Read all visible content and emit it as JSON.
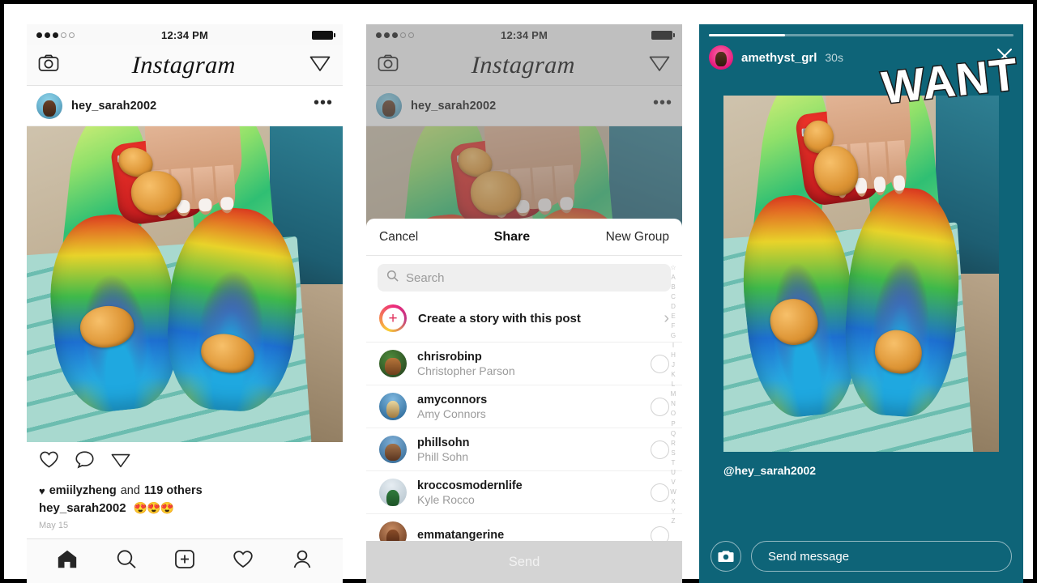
{
  "status_bar": {
    "time": "12:34 PM",
    "signal_filled": 3,
    "signal_empty": 2
  },
  "app": {
    "logo_text": "Instagram"
  },
  "post": {
    "username": "hey_sarah2002",
    "likes_prefix_user": "emiilyzheng",
    "likes_middle": "and",
    "likes_count": "119 others",
    "caption_user": "hey_sarah2002",
    "caption_emojis": "😍😍😍",
    "date": "May 15",
    "more_icon": "more-options-icon"
  },
  "tabbar": {
    "items": [
      {
        "name": "home-icon",
        "label": "Home"
      },
      {
        "name": "search-icon",
        "label": "Search"
      },
      {
        "name": "add-post-icon",
        "label": "Add"
      },
      {
        "name": "activity-heart-icon",
        "label": "Activity"
      },
      {
        "name": "profile-icon",
        "label": "Profile"
      }
    ]
  },
  "share_sheet": {
    "cancel_label": "Cancel",
    "title": "Share",
    "new_group_label": "New Group",
    "search_placeholder": "Search",
    "create_story_label": "Create a story with this post",
    "send_label": "Send",
    "index_letters": [
      "☆",
      "A",
      "B",
      "C",
      "D",
      "E",
      "F",
      "G",
      "I",
      "H",
      "J",
      "K",
      "L",
      "M",
      "N",
      "O",
      "P",
      "Q",
      "R",
      "S",
      "T",
      "U",
      "V",
      "W",
      "X",
      "Y",
      "Z"
    ],
    "contacts": [
      {
        "username": "chrisrobinp",
        "fullname": "Christopher Parson"
      },
      {
        "username": "amyconnors",
        "fullname": "Amy Connors"
      },
      {
        "username": "phillsohn",
        "fullname": "Phill Sohn"
      },
      {
        "username": "kroccosmodernlife",
        "fullname": "Kyle Rocco"
      },
      {
        "username": "emmatangerine",
        "fullname": ""
      }
    ]
  },
  "story": {
    "username": "amethyst_grl",
    "time": "30s",
    "sticker_text": "WANT",
    "mention": "@hey_sarah2002",
    "reply_placeholder": "Send message",
    "progress_percent": 25,
    "background_color": "#0e6478",
    "close_icon": "close-icon",
    "camera_icon": "camera-icon"
  }
}
